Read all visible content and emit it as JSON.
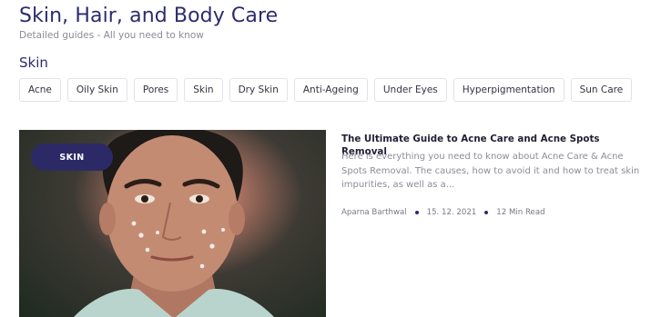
{
  "header": {
    "title": "Skin, Hair, and Body Care",
    "subtitle": "Detailed guides - All you need to know"
  },
  "section": {
    "title": "Skin",
    "tags": [
      "Acne",
      "Oily Skin",
      "Pores",
      "Skin",
      "Dry Skin",
      "Anti-Ageing",
      "Under Eyes",
      "Hyperpigmentation",
      "Sun Care"
    ]
  },
  "article": {
    "category": "SKIN",
    "title": "The Ultimate Guide to Acne Care and Acne Spots Removal",
    "excerpt": "Here is everything you need to know about Acne Care & Acne Spots Removal. The causes, how to avoid it and how to treat skin impurities, as well as a...",
    "author": "Aparna Barthwal",
    "date": "15. 12. 2021",
    "read_time": "12 Min Read",
    "image_subject": "portrait-of-man-with-acne-spots"
  },
  "colors": {
    "brand": "#2c2a66",
    "text_muted": "#8b8b99",
    "tag_border": "#e2e2e8"
  }
}
